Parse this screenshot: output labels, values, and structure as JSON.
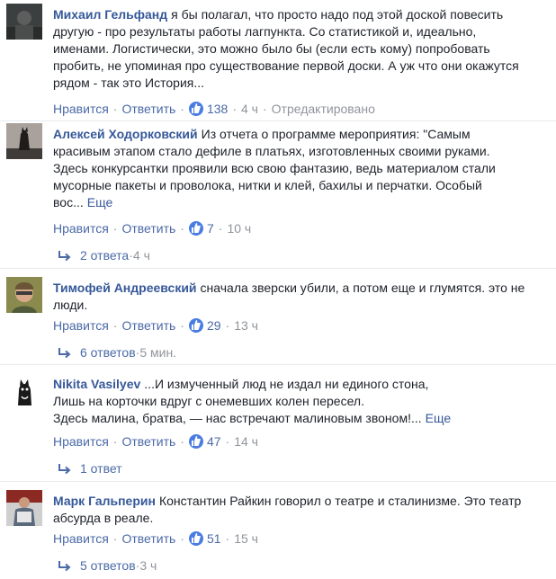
{
  "ui": {
    "like_label": "Нравится",
    "reply_label": "Ответить",
    "separator": "·"
  },
  "comments": [
    {
      "author": "Михаил Гельфанд",
      "text": "я бы полагал, что просто надо под этой доской повесить другую - про результаты работы лагпункта. Со статистикой и, идеально, именами. Логистически, это можно было бы (если есть кому) попробовать пробить, не упоминая про существование первой доски. А уж что они окажутся рядом - так это История...",
      "more": "",
      "likes": "138",
      "time": "4 ч",
      "edited": "Отредактировано",
      "replies": ""
    },
    {
      "author": "Алексей Ходорковский",
      "text": "Из отчета о программе мероприятия: \"Самым красивым этапом стало дефиле в платьях, изготовленных своими руками. Здесь конкурсантки проявили всю свою фантазию, ведь материалом стали мусорные пакеты и проволока, нитки и клей, бахилы и перчатки. Особый вос...",
      "more": "Еще",
      "likes": "7",
      "time": "10 ч",
      "edited": "",
      "replies": "2 ответа",
      "replies_time": "4 ч"
    },
    {
      "author": "Тимофей Андреевский",
      "text": "сначала зверски убили, а потом еще и глумятся. это не люди.",
      "more": "",
      "likes": "29",
      "time": "13 ч",
      "edited": "",
      "replies": "6 ответов",
      "replies_time": "5 мин."
    },
    {
      "author": "Nikita Vasilyev",
      "text_lines": [
        "...И измученный люд не издал ни единого стона,",
        "Лишь на корточки вдруг с онемевших колен пересел.",
        "Здесь малина, братва, — нас встречают малиновым звоном!..."
      ],
      "more": "Еще",
      "likes": "47",
      "time": "14 ч",
      "edited": "",
      "replies": "1 ответ",
      "replies_time": ""
    },
    {
      "author": "Марк Гальперин",
      "text": "Константин Райкин говорил о театре и сталинизме. Это театр абсурда в реале.",
      "more": "",
      "likes": "51",
      "time": "15 ч",
      "edited": "",
      "replies": "5 ответов",
      "replies_time": "3 ч"
    }
  ],
  "colors": {
    "link": "#365899",
    "meta": "#90949c",
    "like_bubble": "#4a7ce2",
    "divider": "#e9ebee"
  }
}
